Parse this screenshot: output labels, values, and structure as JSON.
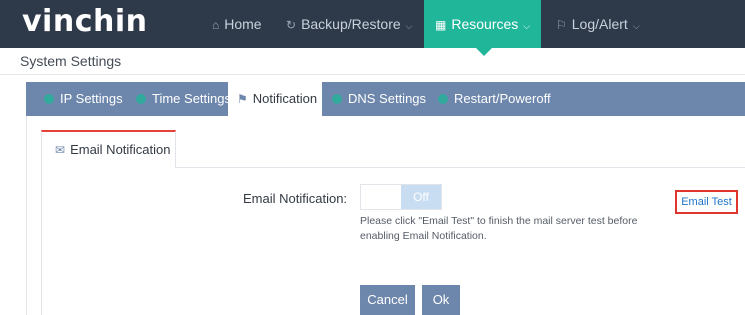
{
  "header": {
    "logo": "vinchin",
    "nav": [
      {
        "label": "Home",
        "icon": "home-icon"
      },
      {
        "label": "Backup/Restore",
        "icon": "backup-restore-icon"
      },
      {
        "label": "Resources",
        "icon": "resources-grid-icon",
        "active": true
      },
      {
        "label": "Log/Alert",
        "icon": "bell-icon"
      }
    ]
  },
  "page": {
    "title": "System Settings"
  },
  "settings_tabs": [
    {
      "label": "IP Settings"
    },
    {
      "label": "Time Settings"
    },
    {
      "label": "Notification",
      "active": true
    },
    {
      "label": "DNS Settings"
    },
    {
      "label": "Restart/Poweroff"
    }
  ],
  "notification": {
    "sub_tab": "Email Notification",
    "field_label": "Email Notification:",
    "toggle_state": "Off",
    "hint": "Please click \"Email Test\" to finish the mail server test before enabling Email Notification.",
    "email_test_label": "Email Test",
    "cancel_label": "Cancel",
    "ok_label": "Ok"
  },
  "colors": {
    "topbar": "#2e3a4a",
    "accent": "#1fb69a",
    "tabs": "#6d86ab",
    "highlight": "#e0352c",
    "link": "#1f74c9"
  }
}
